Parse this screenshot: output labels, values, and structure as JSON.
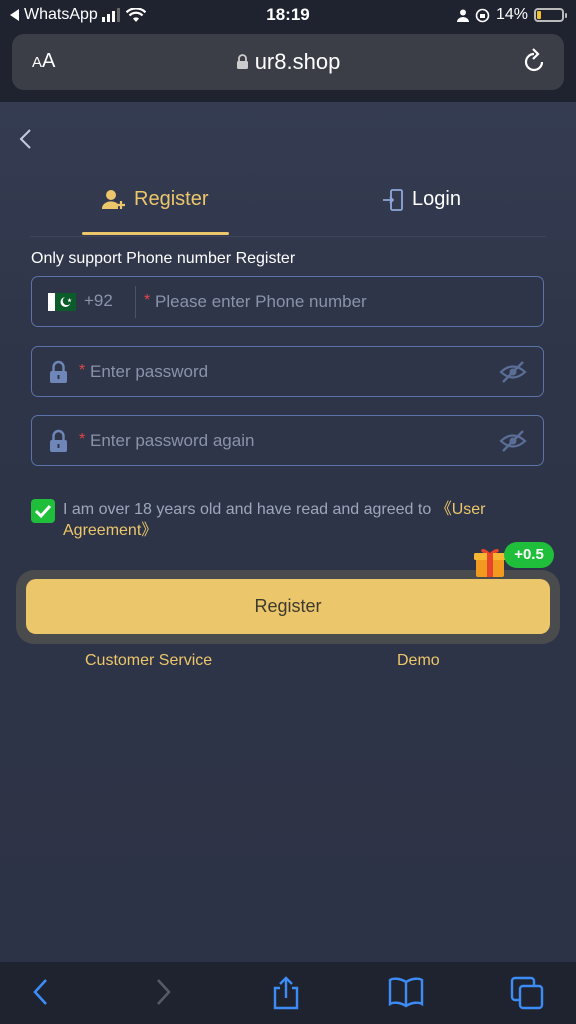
{
  "status": {
    "back_app": "WhatsApp",
    "time": "18:19",
    "battery": "14%"
  },
  "browser": {
    "aa_label_big": "A",
    "aa_label_small": "A",
    "url": "ur8.shop"
  },
  "tabs": {
    "register": "Register",
    "login": "Login"
  },
  "form": {
    "hint": "Only support Phone number Register",
    "country_code": "+92",
    "required_mark": "*",
    "phone_placeholder": "Please enter Phone number",
    "password_placeholder": "Enter password",
    "password_again_placeholder": "Enter password again"
  },
  "agreement": {
    "text": "I am over 18 years old and have read and agreed to ",
    "link": "《User Agreement》"
  },
  "register_button": "Register",
  "bonus": "+0.5",
  "links": {
    "customer_service": "Customer Service",
    "demo": "Demo"
  },
  "colors": {
    "accent": "#ecc66a",
    "background": "#2e3447",
    "field_border": "#5b73a8",
    "check_green": "#1fbe3b",
    "required_red": "#e04545"
  }
}
